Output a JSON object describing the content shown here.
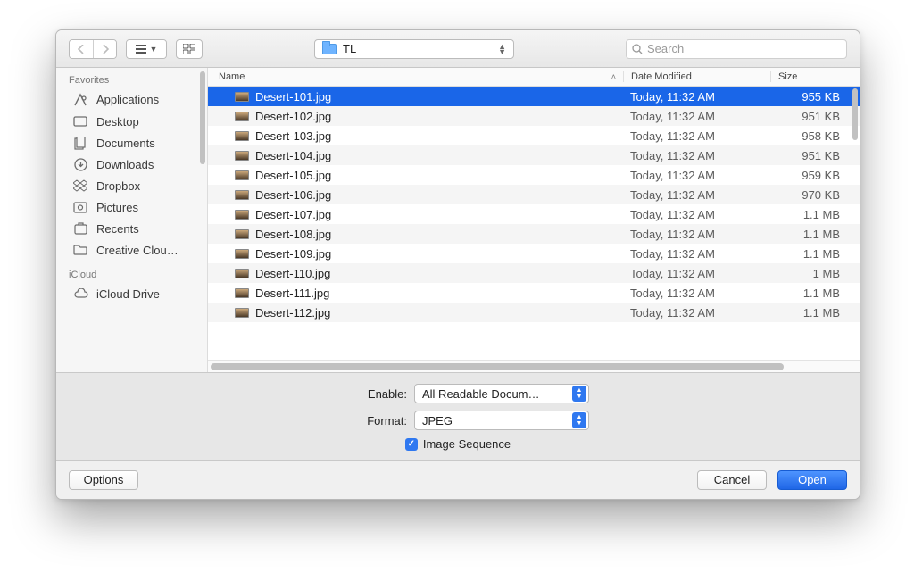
{
  "toolbar": {
    "folder_name": "TL",
    "search_placeholder": "Search"
  },
  "sidebar": {
    "sections": [
      {
        "heading": "Favorites",
        "items": [
          {
            "label": "Applications",
            "icon": "apps-icon"
          },
          {
            "label": "Desktop",
            "icon": "desktop-icon"
          },
          {
            "label": "Documents",
            "icon": "documents-icon"
          },
          {
            "label": "Downloads",
            "icon": "downloads-icon"
          },
          {
            "label": "Dropbox",
            "icon": "dropbox-icon"
          },
          {
            "label": "Pictures",
            "icon": "pictures-icon"
          },
          {
            "label": "Recents",
            "icon": "recents-icon"
          },
          {
            "label": "Creative Clou…",
            "icon": "folder-generic-icon"
          }
        ]
      },
      {
        "heading": "iCloud",
        "items": [
          {
            "label": "iCloud Drive",
            "icon": "icloud-icon"
          }
        ]
      }
    ]
  },
  "columns": {
    "name": "Name",
    "date": "Date Modified",
    "size": "Size"
  },
  "files": [
    {
      "name": "Desert-101.jpg",
      "date": "Today, 11:32 AM",
      "size": "955 KB",
      "selected": true
    },
    {
      "name": "Desert-102.jpg",
      "date": "Today, 11:32 AM",
      "size": "951 KB"
    },
    {
      "name": "Desert-103.jpg",
      "date": "Today, 11:32 AM",
      "size": "958 KB"
    },
    {
      "name": "Desert-104.jpg",
      "date": "Today, 11:32 AM",
      "size": "951 KB"
    },
    {
      "name": "Desert-105.jpg",
      "date": "Today, 11:32 AM",
      "size": "959 KB"
    },
    {
      "name": "Desert-106.jpg",
      "date": "Today, 11:32 AM",
      "size": "970 KB"
    },
    {
      "name": "Desert-107.jpg",
      "date": "Today, 11:32 AM",
      "size": "1.1 MB"
    },
    {
      "name": "Desert-108.jpg",
      "date": "Today, 11:32 AM",
      "size": "1.1 MB"
    },
    {
      "name": "Desert-109.jpg",
      "date": "Today, 11:32 AM",
      "size": "1.1 MB"
    },
    {
      "name": "Desert-110.jpg",
      "date": "Today, 11:32 AM",
      "size": "1 MB"
    },
    {
      "name": "Desert-111.jpg",
      "date": "Today, 11:32 AM",
      "size": "1.1 MB"
    },
    {
      "name": "Desert-112.jpg",
      "date": "Today, 11:32 AM",
      "size": "1.1 MB"
    }
  ],
  "options": {
    "enable_label": "Enable:",
    "enable_value": "All Readable Docum…",
    "format_label": "Format:",
    "format_value": "JPEG",
    "image_sequence_label": "Image Sequence",
    "image_sequence_checked": true
  },
  "footer": {
    "options": "Options",
    "cancel": "Cancel",
    "open": "Open"
  }
}
